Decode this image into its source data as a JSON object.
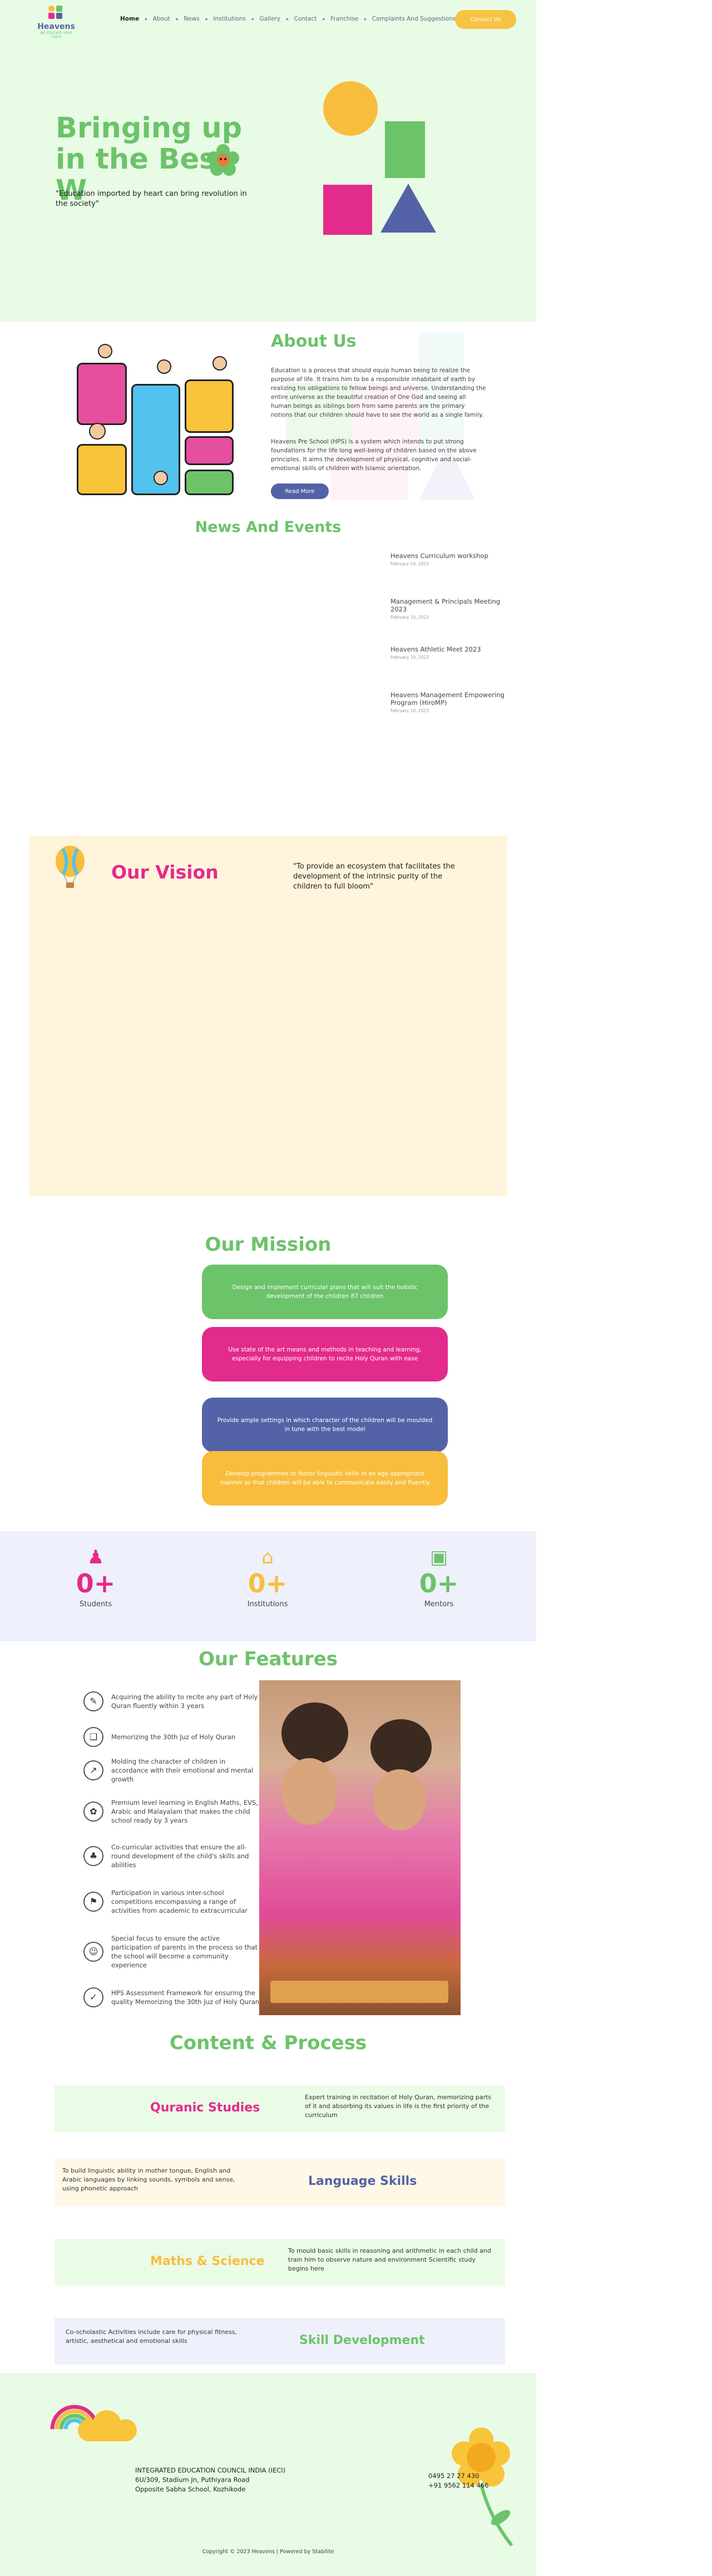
{
  "brand": {
    "name": "Heavens",
    "tagline": "WE EDUCATE YOUR CHILD"
  },
  "nav": {
    "items": [
      "Home",
      "About",
      "News",
      "Institutions",
      "Gallery",
      "Contact",
      "Franchise",
      "Complaints And Suggestions"
    ],
    "active": "Home",
    "contact_button": "Contact Us"
  },
  "hero": {
    "title": "Bringing up in the Best W",
    "quote": "\"Education imported by heart can bring revolution in the society\""
  },
  "about": {
    "title": "About Us",
    "p1": "Education is a process that should equip human being to realize the purpose of life. It trains him to be a responsible inhabitant of earth by realizing his obligations to fellow beings and universe. Understanding the entire universe as the beautiful creation of One God and seeing all human beings as siblings born from same parents are the primary notions that our children should have to see the world as a single family.",
    "p2": "Heavens Pre School (HPS) is a system which intends to put strong foundations for the life long well-being of children based on the above principles. It aims the development of physical, cognitive and social-emotional skills of children with Islamic orientation.",
    "button": "Read More"
  },
  "news": {
    "title": "News And Events",
    "items": [
      {
        "title": "Heavens Curriculum workshop",
        "date": "February 10, 2023"
      },
      {
        "title": "Management & Principals Meeting 2023",
        "date": "February 10, 2023"
      },
      {
        "title": "Heavens Athletic Meet 2023",
        "date": "February 10, 2023"
      },
      {
        "title": "Heavens Management Empowering Program (HiroMP)",
        "date": "February 10, 2023"
      }
    ]
  },
  "vision": {
    "title": "Our Vision",
    "text": "\"To provide an ecosystem that facilitates the development of the intrinsic purity of the children to full bloom\""
  },
  "mission": {
    "title": "Our Mission",
    "items": [
      {
        "text": "Design and implement curricular plans that will suit the holistic development of the children 87 children",
        "color": "#6cc36a"
      },
      {
        "text": "Use state of the art means and methods in teaching and learning, especially for equipping children to recite Holy Quran with ease",
        "color": "#e32b8c"
      },
      {
        "text": "Provide ample settings in which character of the children will be moulded in tune with the best model",
        "color": "#5463a7"
      },
      {
        "text": "Develop programmes to foster linguistic skills in an age appropriate manner so that children will be able to communicate easily and fluently",
        "color": "#f8bd3d"
      }
    ]
  },
  "stats": [
    {
      "icon": "student-icon",
      "value": "0+",
      "label": "Students",
      "color": "#e32b8c"
    },
    {
      "icon": "institution-icon",
      "value": "0+",
      "label": "Institutions",
      "color": "#f8bd3d"
    },
    {
      "icon": "mentor-icon",
      "value": "0+",
      "label": "Mentors",
      "color": "#6cc36a"
    }
  ],
  "features": {
    "title": "Our Features",
    "items": [
      {
        "text": "Acquiring the ability to recite any part of Holy Quran fluently within 3 years",
        "icon": "quran-icon"
      },
      {
        "text": "Memorizing the 30th Juz of Holy Quran",
        "icon": "book-icon"
      },
      {
        "text": "Molding the character of children in accordance with their emotional and mental growth",
        "icon": "growth-icon"
      },
      {
        "text": "Premium level learning in English Maths, EVS, Arabic and Malayalam that makes the child school ready by 3 years",
        "icon": "learning-icon"
      },
      {
        "text": "Co-curricular activities that ensure the all-round development of the child's skills and abilities",
        "icon": "activity-icon"
      },
      {
        "text": "Participation in various inter-school competitions encompassing a range of activities from academic to extracurricular",
        "icon": "competition-icon"
      },
      {
        "text": "Special focus to ensure the active participation of parents in the process so that the school will become a community experience",
        "icon": "parents-icon"
      },
      {
        "text": "HPS Assessment Framework for ensuring the quality Memorizing the 30th Juz of Holy Quran",
        "icon": "assessment-icon"
      }
    ]
  },
  "process": {
    "title": "Content & Process",
    "items": [
      {
        "heading": "Quranic Studies",
        "text": "Expert training in recitation of Holy Quran, memorizing parts of it and absorbing its values in life is the first priority of the curriculum",
        "bg": "#eafbe6",
        "color": "#e32b8c"
      },
      {
        "heading": "Language Skills",
        "text": "To build linguistic ability in mother tongue, English and Arabic languages by linking sounds, symbols and sense, using phonetic approach",
        "bg": "#fff8e6",
        "color": "#5463a7"
      },
      {
        "heading": "Maths & Science",
        "text": "To mould basic skills in reasoning and arithmetic in each child and train him to observe nature and environment Scientific study begins here",
        "bg": "#eafbe6",
        "color": "#f8bd3d"
      },
      {
        "heading": "Skill Development",
        "text": "Co-scholastic Activities include care for physical fitness, artistic, aesthetical and emotional skills",
        "bg": "#eef1fc",
        "color": "#6cc36a"
      }
    ]
  },
  "footer": {
    "address": [
      "INTEGRATED EDUCATION COUNCIL INDIA (IECI)",
      "6U/309, Stadium Jn, Puthiyara Road",
      "Opposite Sabha School, Kozhikode"
    ],
    "phones": [
      "0495 27 27 430",
      "+91 9562 114 466"
    ],
    "copyright": "Copyright © 2023 Heavens | Powered by Stabilite"
  }
}
